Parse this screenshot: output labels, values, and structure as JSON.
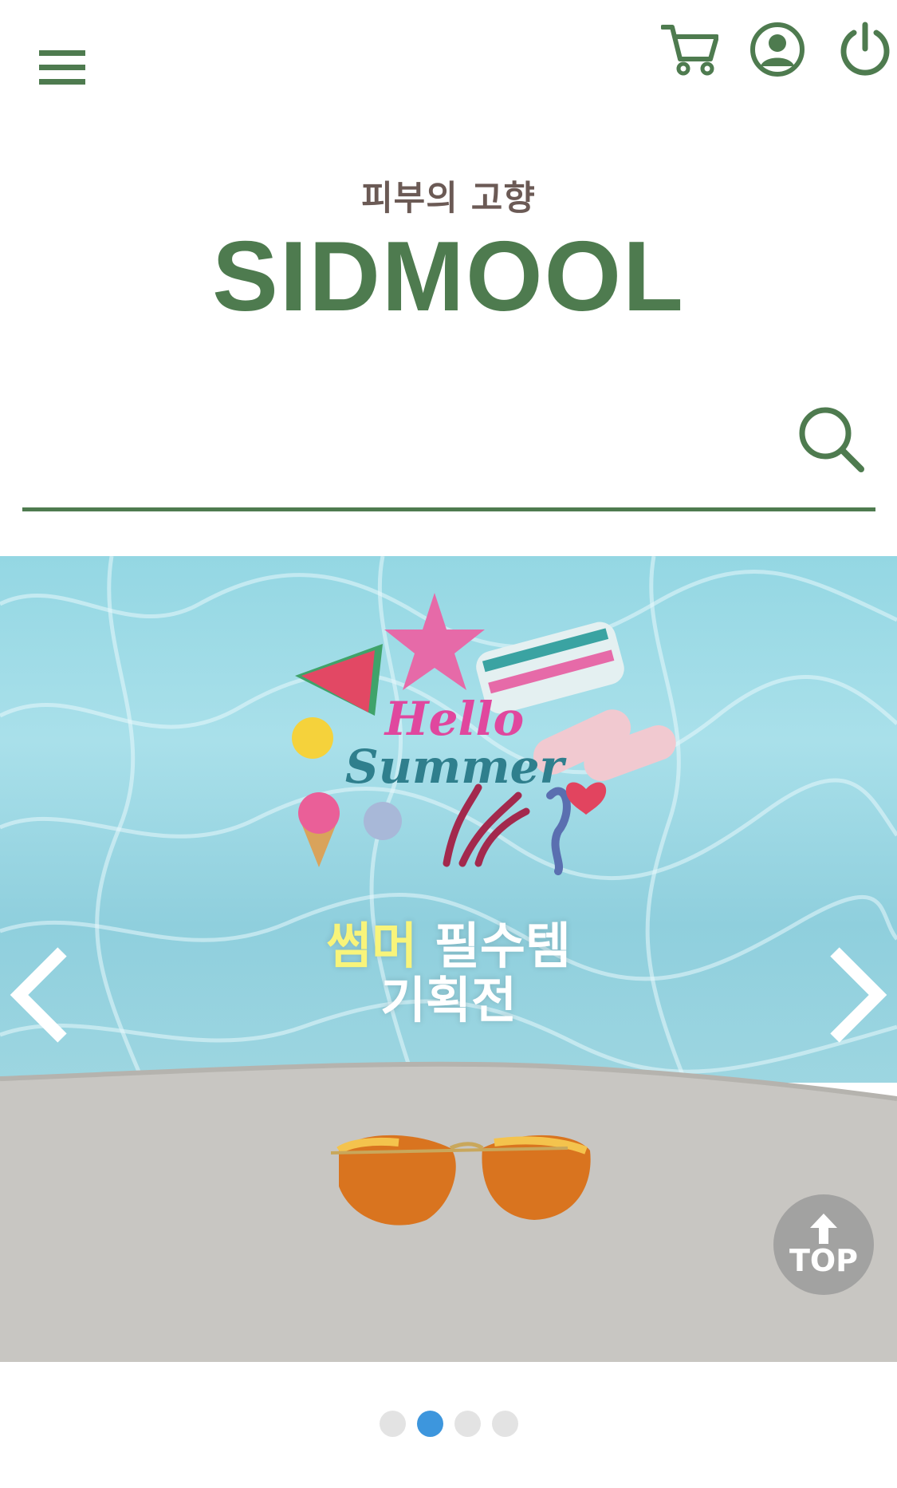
{
  "header": {
    "menu_icon": "hamburger-menu-icon",
    "cart_icon": "cart-icon",
    "account_icon": "user-account-icon",
    "power_icon": "power-icon"
  },
  "brand": {
    "tagline": "피부의 고향",
    "name": "SIDMOOL"
  },
  "search": {
    "placeholder": "",
    "value": "",
    "icon": "search-icon"
  },
  "banner": {
    "hello_line1": "Hello",
    "hello_line2": "Summer",
    "title_highlight": "썸머",
    "title_rest": "필수템",
    "subtitle": "기획전",
    "prev_icon": "chevron-left-icon",
    "next_icon": "chevron-right-icon"
  },
  "top_button": {
    "label": "TOP",
    "icon": "arrow-up-icon"
  },
  "carousel": {
    "slide_count": 4,
    "active_index": 1
  },
  "colors": {
    "brand_green": "#4e7b4f",
    "tagline_brown": "#6b5a55",
    "dot_active": "#3d96dd",
    "dot_inactive": "#e3e3e3",
    "highlight_yellow": "#f8f47a"
  }
}
